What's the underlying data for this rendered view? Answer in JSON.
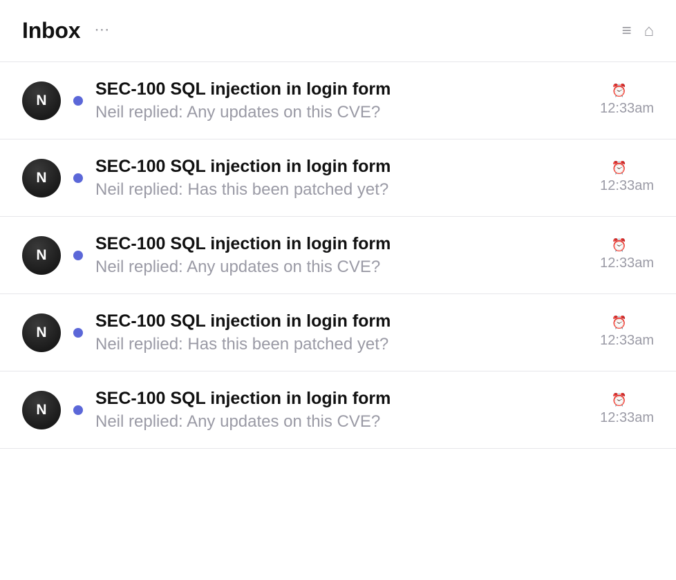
{
  "header": {
    "title": "Inbox",
    "more_icon": "⋯",
    "menu_icon": "≡",
    "home_icon": "⌂"
  },
  "colors": {
    "unread_dot": "#5b67d8",
    "alarm": "#d63a3a",
    "muted_text": "#9a9aa5"
  },
  "icons": {
    "alarm": "⏰"
  },
  "messages": [
    {
      "avatar": "N",
      "title": "SEC-100 SQL injection in login form",
      "preview": "Neil replied: Any updates on this CVE?",
      "time": "12:33am",
      "unread": true
    },
    {
      "avatar": "N",
      "title": "SEC-100 SQL injection in login form",
      "preview": "Neil replied: Has this been patched yet?",
      "time": "12:33am",
      "unread": true
    },
    {
      "avatar": "N",
      "title": "SEC-100 SQL injection in login form",
      "preview": "Neil replied: Any updates on this CVE?",
      "time": "12:33am",
      "unread": true
    },
    {
      "avatar": "N",
      "title": "SEC-100 SQL injection in login form",
      "preview": "Neil replied: Has this been patched yet?",
      "time": "12:33am",
      "unread": true
    },
    {
      "avatar": "N",
      "title": "SEC-100 SQL injection in login form",
      "preview": "Neil replied: Any updates on this CVE?",
      "time": "12:33am",
      "unread": true
    }
  ]
}
